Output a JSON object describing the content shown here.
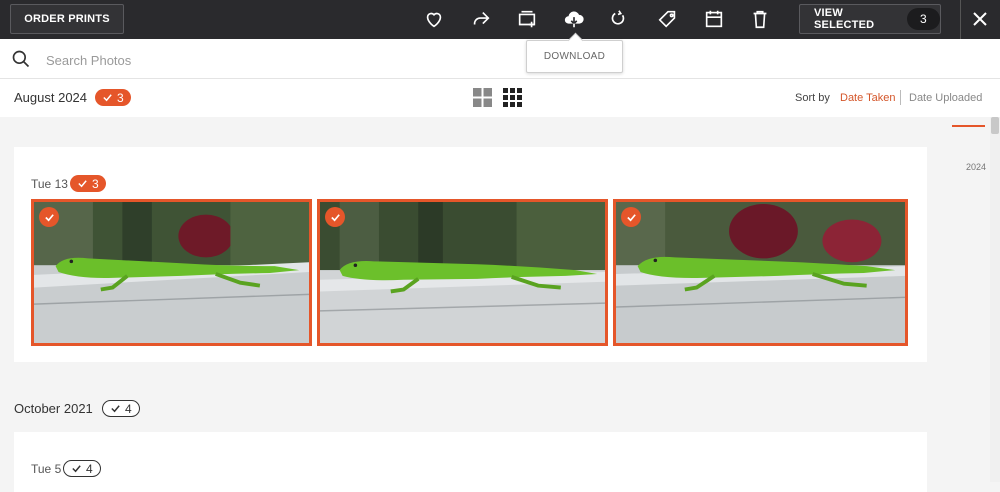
{
  "toolbar": {
    "order_prints": "ORDER PRINTS",
    "view_selected": "VIEW SELECTED",
    "selected_count": "3",
    "icons": [
      "heart-icon",
      "share-icon",
      "add-to-album-icon",
      "download-icon",
      "rotate-icon",
      "tag-icon",
      "calendar-icon",
      "trash-icon"
    ],
    "tooltip": "DOWNLOAD"
  },
  "search": {
    "placeholder": "Search Photos"
  },
  "header": {
    "month": "August 2024",
    "month_count": "3",
    "sort_by": "Sort by",
    "sort_taken": "Date Taken",
    "sort_uploaded": "Date Uploaded",
    "active_sort": "Date Taken"
  },
  "timeline": {
    "year": "2024"
  },
  "groups": [
    {
      "day": "Tue 13",
      "count": "3",
      "photos": [
        {
          "selected": true
        },
        {
          "selected": true
        },
        {
          "selected": true
        }
      ]
    },
    {
      "month": "October 2021",
      "month_count": "4",
      "day": "Tue 5",
      "count": "4"
    }
  ],
  "colors": {
    "accent": "#e5562a",
    "topbar": "#2a2a2d"
  }
}
